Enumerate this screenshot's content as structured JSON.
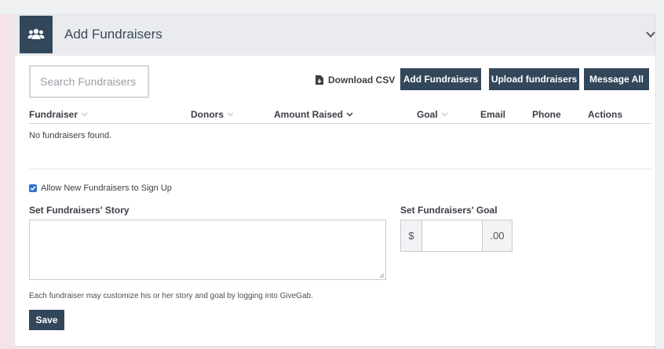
{
  "colors": {
    "primary": "#33475b",
    "checkbox": "#2f6fd1",
    "header_bg": "#e9ebee"
  },
  "header": {
    "title": "Add Fundraisers",
    "icon": "people-group-icon",
    "collapse_icon": "chevron-down-icon"
  },
  "toolbar": {
    "search_placeholder": "Search Fundraisers",
    "download_csv": "Download CSV",
    "download_icon": "file-download-icon",
    "add_fundraisers": "Add Fundraisers",
    "upload_fundraisers": "Upload fundraisers",
    "message_all": "Message All"
  },
  "table": {
    "columns": [
      {
        "label": "Fundraiser",
        "caret": "light"
      },
      {
        "label": "Donors",
        "caret": "light"
      },
      {
        "label": "Amount Raised",
        "caret": "dark"
      },
      {
        "label": "Goal",
        "caret": "light"
      },
      {
        "label": "Email"
      },
      {
        "label": "Phone"
      },
      {
        "label": "Actions"
      }
    ],
    "empty_message": "No fundraisers found."
  },
  "settings": {
    "allow_signup_label": "Allow New Fundraisers to Sign Up",
    "allow_signup_checked": true,
    "story_label": "Set Fundraisers' Story",
    "story_value": "",
    "goal_label": "Set Fundraisers' Goal",
    "goal_prefix": "$",
    "goal_value": "",
    "goal_suffix": ".00",
    "help_text": "Each fundraiser may customize his or her story and goal by logging into GiveGab.",
    "save_label": "Save"
  }
}
